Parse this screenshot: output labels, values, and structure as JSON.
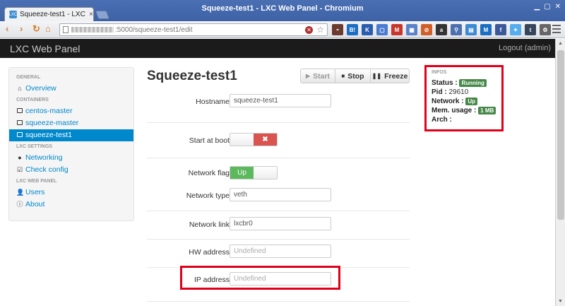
{
  "browser": {
    "tab_title": "Squeeze-test1 - LXC We",
    "tab_close": "×",
    "favicon": "LXC",
    "window_title": "Squeeze-test1 - LXC Web Panel - Chromium",
    "url_path": ":5000/squeeze-test1/edit",
    "nav_back": "‹",
    "nav_forward": "›",
    "nav_reload": "↻",
    "nav_home": "⌂",
    "stop_glyph": "✕",
    "star_glyph": "☆",
    "extensions": [
      {
        "name": "mask-ext-icon",
        "label": "◓",
        "color": "#6b3b2f"
      },
      {
        "name": "hatena-ext-icon",
        "label": "B!",
        "color": "#1b6ec1"
      },
      {
        "name": "k-ext-icon",
        "label": "K",
        "color": "#2a5db0"
      },
      {
        "name": "window-ext-icon",
        "label": "▢",
        "color": "#4a7bd0"
      },
      {
        "name": "gmail-ext-icon",
        "label": "M",
        "color": "#c8372d"
      },
      {
        "name": "calendar-ext-icon",
        "label": "▦",
        "color": "#5a82c8"
      },
      {
        "name": "block-ext-icon",
        "label": "⊘",
        "color": "#d0602a"
      },
      {
        "name": "amazon-ext-icon",
        "label": "a",
        "color": "#333333"
      },
      {
        "name": "bookmark-ext-icon",
        "label": "⚲",
        "color": "#4d6fb0"
      },
      {
        "name": "stack-ext-icon",
        "label": "▤",
        "color": "#3c8ad4"
      },
      {
        "name": "m-ext-icon",
        "label": "M",
        "color": "#1b6ec1"
      },
      {
        "name": "facebook-ext-icon",
        "label": "f",
        "color": "#3b5998"
      },
      {
        "name": "twitter-ext-icon",
        "label": "✦",
        "color": "#55acee"
      },
      {
        "name": "tumblr-ext-icon",
        "label": "t",
        "color": "#35465c"
      },
      {
        "name": "gear-ext-icon",
        "label": "⚙",
        "color": "#666666"
      }
    ]
  },
  "navbar": {
    "brand": "LXC Web Panel",
    "logout": "Logout (admin)"
  },
  "sidebar": {
    "general_header": "GENERAL",
    "overview": "Overview",
    "containers_header": "CONTAINERS",
    "containers": [
      "centos-master",
      "squeeze-master",
      "squeeze-test1"
    ],
    "lxc_settings_header": "LXC SETTINGS",
    "networking": "Networking",
    "check_config": "Check config",
    "lxc_web_panel_header": "LXC WEB PANEL",
    "users": "Users",
    "about": "About"
  },
  "main": {
    "title": "Squeeze-test1",
    "start_label": "Start",
    "stop_label": "Stop",
    "freeze_label": "Freeze",
    "hostname_label": "Hostname",
    "hostname_value": "squeeze-test1",
    "start_at_boot_label": "Start at boot",
    "start_at_boot_off": "✖",
    "network_flag_label": "Network flag",
    "network_flag_on": "Up",
    "network_type_label": "Network type",
    "network_type_value": "veth",
    "network_link_label": "Network link",
    "network_link_value": "lxcbr0",
    "hw_address_label": "HW address",
    "hw_address_placeholder": "Undefined",
    "ip_address_label": "IP address",
    "ip_address_placeholder": "Undefined"
  },
  "infos": {
    "header": "INFOS",
    "status_label": "Status :",
    "status_value": "Running",
    "pid_label": "Pid :",
    "pid_value": "29610",
    "network_label": "Network :",
    "network_value": "Up",
    "mem_label": "Mem. usage :",
    "mem_value": "1 MB",
    "arch_label": "Arch :"
  },
  "colors": {
    "accent": "#0088cc",
    "success": "#5cb85c",
    "danger": "#d9534f",
    "highlight": "#e0001a"
  }
}
